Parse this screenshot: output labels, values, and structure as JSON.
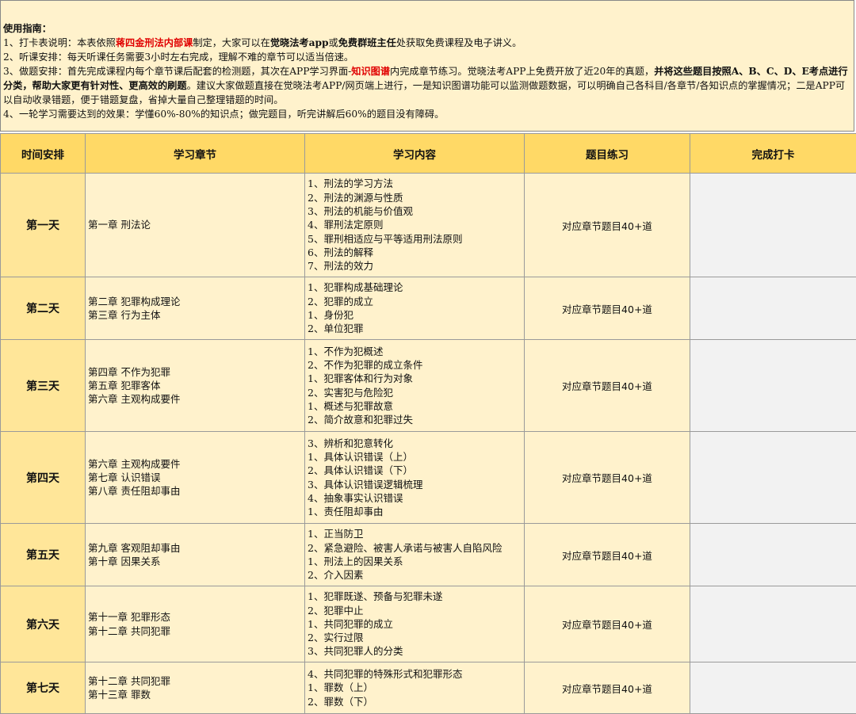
{
  "guide": {
    "title": "使用指南：",
    "p1": {
      "a": "1、打卡表说明：本表依照",
      "b": "蒋四金刑法内部课",
      "c": "制定，大家可以在",
      "d": "觉晓法考app",
      "e": "或",
      "f": "免费群班主任",
      "g": "处获取免费课程及电子讲义。"
    },
    "p2": "2、听课安排：每天听课任务需要3小时左右完成，理解不难的章节可以适当倍速。",
    "p3": {
      "a": "3、做题安排：首先完成课程内每个章节课后配套的检测题，其次在APP学习界面-",
      "b": "知识图谱",
      "c": "内完成章节练习。觉晓法考APP上免费开放了近20年的真题，",
      "d": "并将这些题目按照A、B、C、D、E考点进行分类，帮助大家更有针对性、更高效的刷题",
      "e": "。建议大家做题直接在觉晓法考APP/网页端上进行，一是知识图谱功能可以监测做题数据，可以明确自己各科目/各章节/各知识点的掌握情况；二是APP可以自动收录错题，便于错题复盘，省掉大量自己整理错题的时间。"
    },
    "p4": "4、一轮学习需要达到的效果：学懂60%-80%的知识点；做完题目，听完讲解后60%的题目没有障碍。"
  },
  "headers": [
    "时间安排",
    "学习章节",
    "学习内容",
    "题目练习",
    "完成打卡"
  ],
  "rows": [
    {
      "day": "第一天",
      "chapters": [
        "第一章 刑法论"
      ],
      "content": [
        "1、刑法的学习方法",
        "2、刑法的渊源与性质",
        "3、刑法的机能与价值观",
        "4、罪刑法定原则",
        "5、罪刑相适应与平等适用刑法原则",
        "6、刑法的解释",
        "7、刑法的效力"
      ],
      "exercise": "对应章节题目40+道",
      "done": ""
    },
    {
      "day": "第二天",
      "chapters": [
        "第二章 犯罪构成理论",
        "第三章 行为主体"
      ],
      "content": [
        "1、犯罪构成基础理论",
        "2、犯罪的成立",
        "1、身份犯",
        "2、单位犯罪"
      ],
      "exercise": "对应章节题目40+道",
      "done": ""
    },
    {
      "day": "第三天",
      "chapters": [
        "第四章 不作为犯罪",
        "第五章 犯罪客体",
        "第六章 主观构成要件"
      ],
      "content": [
        "1、不作为犯概述",
        "2、不作为犯罪的成立条件",
        "1、犯罪客体和行为对象",
        "2、实害犯与危险犯",
        "1、概述与犯罪故意",
        "2、简介故意和犯罪过失"
      ],
      "exercise": "对应章节题目40+道",
      "done": ""
    },
    {
      "day": "第四天",
      "chapters": [
        "第六章 主观构成要件",
        "第七章 认识错误",
        "第八章 责任阻却事由"
      ],
      "content": [
        "3、辨析和犯意转化",
        "1、具体认识错误（上）",
        "2、具体认识错误（下）",
        "3、具体认识错误逻辑梳理",
        "4、抽象事实认识错误",
        "1、责任阻却事由"
      ],
      "exercise": "对应章节题目40+道",
      "done": ""
    },
    {
      "day": "第五天",
      "chapters": [
        "第九章 客观阻却事由",
        "第十章 因果关系"
      ],
      "content": [
        "1、正当防卫",
        "2、紧急避险、被害人承诺与被害人自陷风险",
        "1、刑法上的因果关系",
        "2、介入因素"
      ],
      "exercise": "对应章节题目40+道",
      "done": ""
    },
    {
      "day": "第六天",
      "chapters": [
        "第十一章 犯罪形态",
        "第十二章 共同犯罪"
      ],
      "content": [
        "1、犯罪既遂、预备与犯罪未遂",
        "2、犯罪中止",
        "1、共同犯罪的成立",
        "2、实行过限",
        "3、共同犯罪人的分类"
      ],
      "exercise": "对应章节题目40+道",
      "done": ""
    },
    {
      "day": "第七天",
      "chapters": [
        "第十二章 共同犯罪",
        "第十三章 罪数"
      ],
      "content": [
        "4、共同犯罪的特殊形式和犯罪形态",
        "1、罪数（上）",
        "2、罪数（下）"
      ],
      "exercise": "对应章节题目40+道",
      "done": ""
    }
  ]
}
